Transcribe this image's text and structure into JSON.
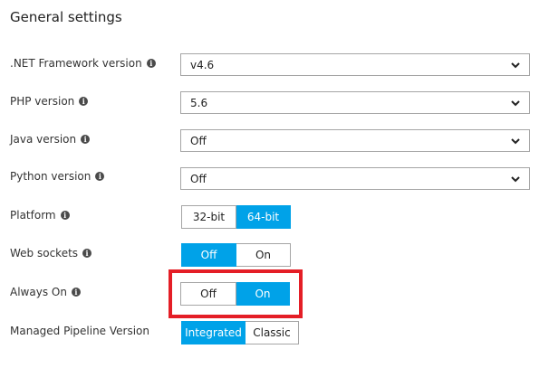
{
  "section_title": "General settings",
  "colors": {
    "accent": "#00a2e8",
    "highlight": "#e41e26"
  },
  "settings": {
    "net_framework": {
      "label": ".NET Framework version",
      "value": "v4.6"
    },
    "php": {
      "label": "PHP version",
      "value": "5.6"
    },
    "java": {
      "label": "Java version",
      "value": "Off"
    },
    "python": {
      "label": "Python version",
      "value": "Off"
    },
    "platform": {
      "label": "Platform",
      "options": [
        "32-bit",
        "64-bit"
      ],
      "selected": "64-bit"
    },
    "web_sockets": {
      "label": "Web sockets",
      "options": [
        "Off",
        "On"
      ],
      "selected": "Off"
    },
    "always_on": {
      "label": "Always On",
      "options": [
        "Off",
        "On"
      ],
      "selected": "On"
    },
    "managed_pipeline": {
      "label": "Managed Pipeline Version",
      "options": [
        "Integrated",
        "Classic"
      ],
      "selected": "Integrated"
    }
  }
}
